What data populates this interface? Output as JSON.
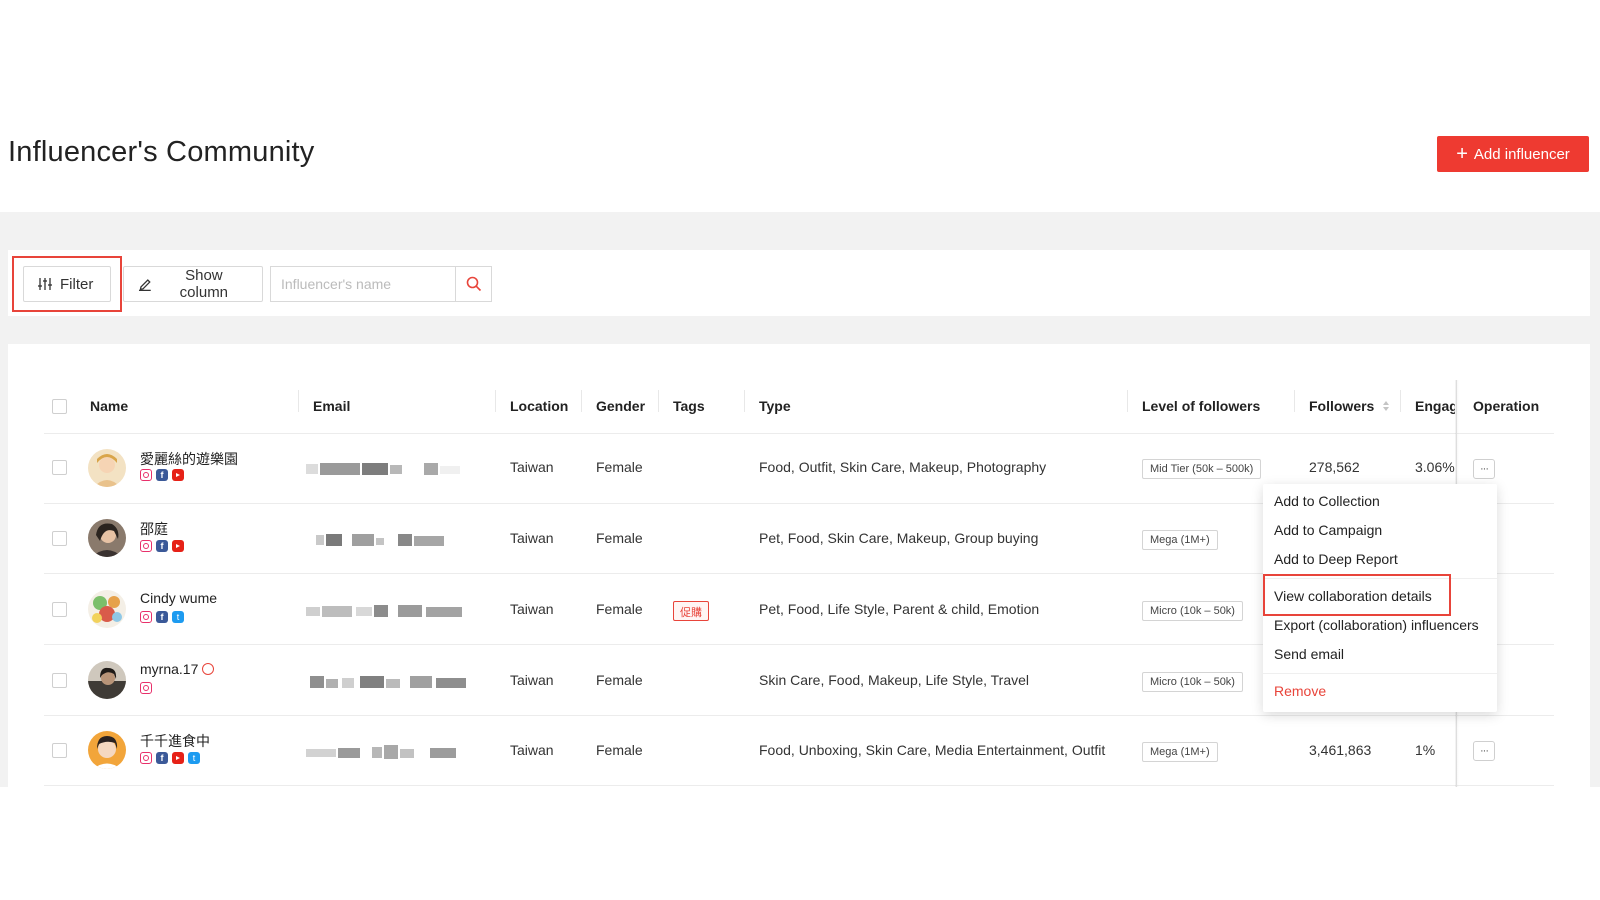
{
  "header": {
    "title": "Influencer's Community",
    "add_button": "Add influencer"
  },
  "toolbar": {
    "filter_label": "Filter",
    "show_column_label": "Show column",
    "search_placeholder": "Influencer's name"
  },
  "table": {
    "columns": {
      "name": "Name",
      "email": "Email",
      "location": "Location",
      "gender": "Gender",
      "tags": "Tags",
      "type": "Type",
      "level": "Level of followers",
      "followers": "Followers",
      "engagement": "Engage",
      "operation": "Operation"
    },
    "rows": [
      {
        "name": "愛麗絲的遊樂園",
        "socials": [
          "instagram",
          "facebook",
          "youtube"
        ],
        "verified": false,
        "location": "Taiwan",
        "gender": "Female",
        "tag": "",
        "type": "Food, Outfit, Skin Care, Makeup, Photography",
        "level": "Mid Tier (50k – 500k)",
        "followers": "278,562",
        "engagement": "3.06%"
      },
      {
        "name": "邵庭",
        "socials": [
          "instagram",
          "facebook",
          "youtube"
        ],
        "verified": false,
        "location": "Taiwan",
        "gender": "Female",
        "tag": "",
        "type": "Pet, Food, Skin Care, Makeup, Group buying",
        "level": "Mega (1M+)",
        "followers": "",
        "engagement": ""
      },
      {
        "name": "Cindy wume",
        "socials": [
          "instagram",
          "facebook",
          "twitter"
        ],
        "verified": false,
        "location": "Taiwan",
        "gender": "Female",
        "tag": "促購",
        "type": "Pet, Food, Life Style, Parent & child, Emotion",
        "level": "Micro (10k – 50k)",
        "followers": "",
        "engagement": ""
      },
      {
        "name": "myrna.17",
        "socials": [
          "instagram"
        ],
        "verified": true,
        "location": "Taiwan",
        "gender": "Female",
        "tag": "",
        "type": "Skin Care, Food, Makeup, Life Style, Travel",
        "level": "Micro (10k – 50k)",
        "followers": "",
        "engagement": ""
      },
      {
        "name": "千千進食中",
        "socials": [
          "instagram",
          "facebook",
          "youtube",
          "twitter"
        ],
        "verified": false,
        "location": "Taiwan",
        "gender": "Female",
        "tag": "",
        "type": "Food, Unboxing, Skin Care, Media Entertainment, Outfit",
        "level": "Mega (1M+)",
        "followers": "3,461,863",
        "engagement": "1%"
      }
    ]
  },
  "operation_menu": {
    "items": [
      {
        "label": "Add to Collection"
      },
      {
        "label": "Add to Campaign"
      },
      {
        "label": "Add to Deep Report"
      },
      {
        "label": "View collaboration details"
      },
      {
        "label": "Export (collaboration) influencers"
      },
      {
        "label": "Send email"
      },
      {
        "label": "Remove"
      }
    ]
  },
  "colors": {
    "accent": "#ee3a31",
    "highlight": "#e8443a",
    "background_band": "#f2f2f2"
  }
}
